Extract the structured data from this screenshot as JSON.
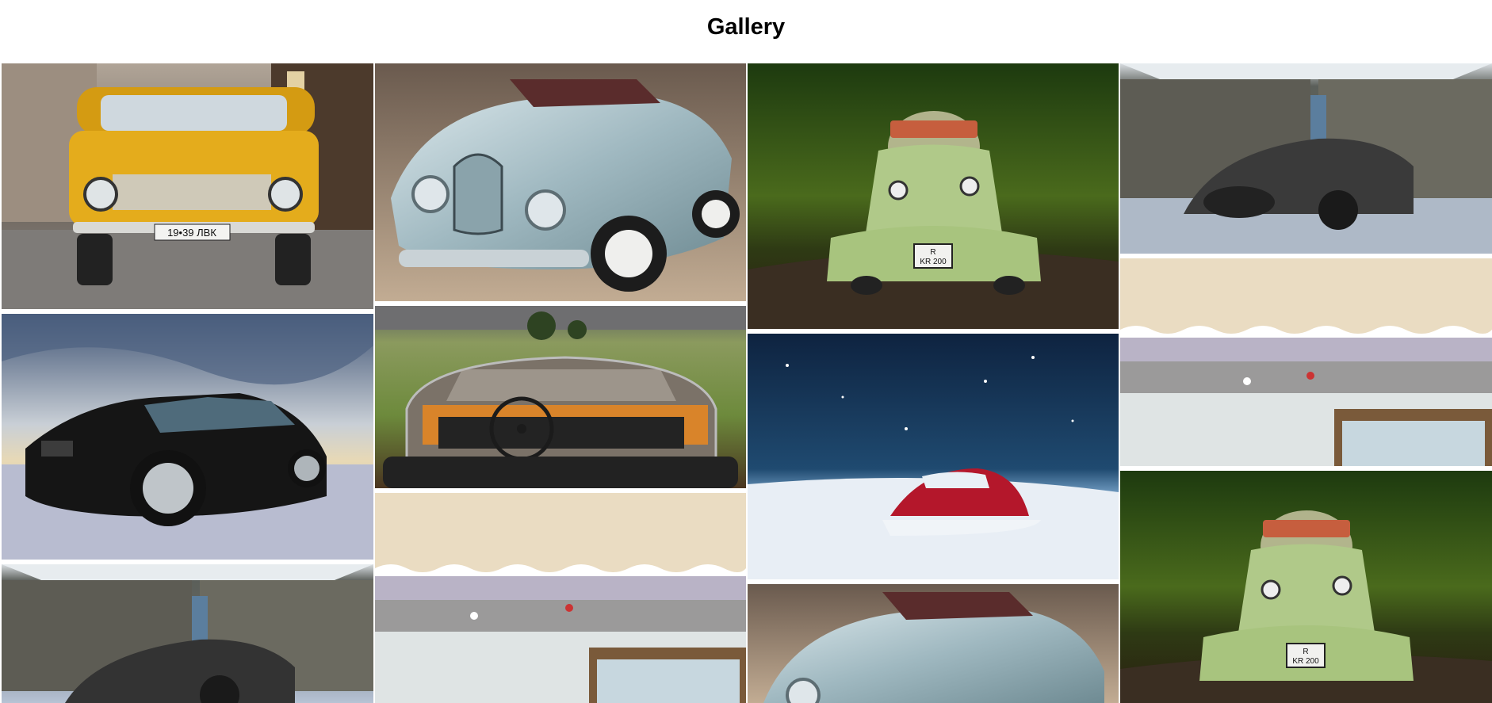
{
  "page": {
    "title": "Gallery"
  },
  "gallery": {
    "items": [
      {
        "alt": "yellow-lada"
      },
      {
        "alt": "silver-convertible"
      },
      {
        "alt": "green-microcar"
      },
      {
        "alt": "maserati-garage"
      },
      {
        "alt": "black-mustang"
      },
      {
        "alt": "convertible-interior"
      },
      {
        "alt": "red-beetle-snow"
      },
      {
        "alt": "beach-aerial"
      },
      {
        "alt": "maserati-garage"
      },
      {
        "alt": "beach-aerial"
      },
      {
        "alt": "silver-convertible"
      },
      {
        "alt": "green-microcar"
      }
    ]
  },
  "plates": {
    "lada": "19•39 ЛВК",
    "microcar_line1": "R",
    "microcar_line2": "KR 200"
  }
}
